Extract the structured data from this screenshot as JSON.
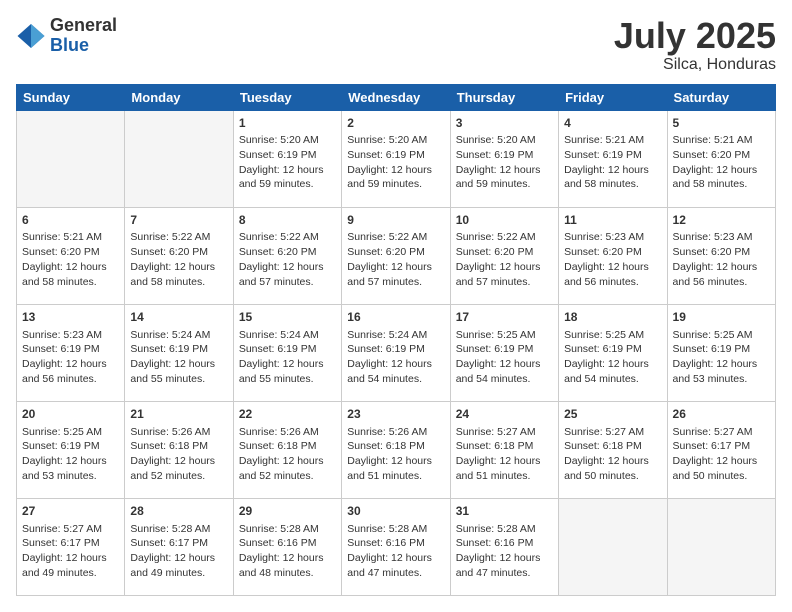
{
  "logo": {
    "general": "General",
    "blue": "Blue"
  },
  "header": {
    "month": "July 2025",
    "location": "Silca, Honduras"
  },
  "weekdays": [
    "Sunday",
    "Monday",
    "Tuesday",
    "Wednesday",
    "Thursday",
    "Friday",
    "Saturday"
  ],
  "weeks": [
    [
      {
        "day": "",
        "empty": true
      },
      {
        "day": "",
        "empty": true
      },
      {
        "day": "1",
        "sunrise": "Sunrise: 5:20 AM",
        "sunset": "Sunset: 6:19 PM",
        "daylight": "Daylight: 12 hours and 59 minutes."
      },
      {
        "day": "2",
        "sunrise": "Sunrise: 5:20 AM",
        "sunset": "Sunset: 6:19 PM",
        "daylight": "Daylight: 12 hours and 59 minutes."
      },
      {
        "day": "3",
        "sunrise": "Sunrise: 5:20 AM",
        "sunset": "Sunset: 6:19 PM",
        "daylight": "Daylight: 12 hours and 59 minutes."
      },
      {
        "day": "4",
        "sunrise": "Sunrise: 5:21 AM",
        "sunset": "Sunset: 6:19 PM",
        "daylight": "Daylight: 12 hours and 58 minutes."
      },
      {
        "day": "5",
        "sunrise": "Sunrise: 5:21 AM",
        "sunset": "Sunset: 6:20 PM",
        "daylight": "Daylight: 12 hours and 58 minutes."
      }
    ],
    [
      {
        "day": "6",
        "sunrise": "Sunrise: 5:21 AM",
        "sunset": "Sunset: 6:20 PM",
        "daylight": "Daylight: 12 hours and 58 minutes."
      },
      {
        "day": "7",
        "sunrise": "Sunrise: 5:22 AM",
        "sunset": "Sunset: 6:20 PM",
        "daylight": "Daylight: 12 hours and 58 minutes."
      },
      {
        "day": "8",
        "sunrise": "Sunrise: 5:22 AM",
        "sunset": "Sunset: 6:20 PM",
        "daylight": "Daylight: 12 hours and 57 minutes."
      },
      {
        "day": "9",
        "sunrise": "Sunrise: 5:22 AM",
        "sunset": "Sunset: 6:20 PM",
        "daylight": "Daylight: 12 hours and 57 minutes."
      },
      {
        "day": "10",
        "sunrise": "Sunrise: 5:22 AM",
        "sunset": "Sunset: 6:20 PM",
        "daylight": "Daylight: 12 hours and 57 minutes."
      },
      {
        "day": "11",
        "sunrise": "Sunrise: 5:23 AM",
        "sunset": "Sunset: 6:20 PM",
        "daylight": "Daylight: 12 hours and 56 minutes."
      },
      {
        "day": "12",
        "sunrise": "Sunrise: 5:23 AM",
        "sunset": "Sunset: 6:20 PM",
        "daylight": "Daylight: 12 hours and 56 minutes."
      }
    ],
    [
      {
        "day": "13",
        "sunrise": "Sunrise: 5:23 AM",
        "sunset": "Sunset: 6:19 PM",
        "daylight": "Daylight: 12 hours and 56 minutes."
      },
      {
        "day": "14",
        "sunrise": "Sunrise: 5:24 AM",
        "sunset": "Sunset: 6:19 PM",
        "daylight": "Daylight: 12 hours and 55 minutes."
      },
      {
        "day": "15",
        "sunrise": "Sunrise: 5:24 AM",
        "sunset": "Sunset: 6:19 PM",
        "daylight": "Daylight: 12 hours and 55 minutes."
      },
      {
        "day": "16",
        "sunrise": "Sunrise: 5:24 AM",
        "sunset": "Sunset: 6:19 PM",
        "daylight": "Daylight: 12 hours and 54 minutes."
      },
      {
        "day": "17",
        "sunrise": "Sunrise: 5:25 AM",
        "sunset": "Sunset: 6:19 PM",
        "daylight": "Daylight: 12 hours and 54 minutes."
      },
      {
        "day": "18",
        "sunrise": "Sunrise: 5:25 AM",
        "sunset": "Sunset: 6:19 PM",
        "daylight": "Daylight: 12 hours and 54 minutes."
      },
      {
        "day": "19",
        "sunrise": "Sunrise: 5:25 AM",
        "sunset": "Sunset: 6:19 PM",
        "daylight": "Daylight: 12 hours and 53 minutes."
      }
    ],
    [
      {
        "day": "20",
        "sunrise": "Sunrise: 5:25 AM",
        "sunset": "Sunset: 6:19 PM",
        "daylight": "Daylight: 12 hours and 53 minutes."
      },
      {
        "day": "21",
        "sunrise": "Sunrise: 5:26 AM",
        "sunset": "Sunset: 6:18 PM",
        "daylight": "Daylight: 12 hours and 52 minutes."
      },
      {
        "day": "22",
        "sunrise": "Sunrise: 5:26 AM",
        "sunset": "Sunset: 6:18 PM",
        "daylight": "Daylight: 12 hours and 52 minutes."
      },
      {
        "day": "23",
        "sunrise": "Sunrise: 5:26 AM",
        "sunset": "Sunset: 6:18 PM",
        "daylight": "Daylight: 12 hours and 51 minutes."
      },
      {
        "day": "24",
        "sunrise": "Sunrise: 5:27 AM",
        "sunset": "Sunset: 6:18 PM",
        "daylight": "Daylight: 12 hours and 51 minutes."
      },
      {
        "day": "25",
        "sunrise": "Sunrise: 5:27 AM",
        "sunset": "Sunset: 6:18 PM",
        "daylight": "Daylight: 12 hours and 50 minutes."
      },
      {
        "day": "26",
        "sunrise": "Sunrise: 5:27 AM",
        "sunset": "Sunset: 6:17 PM",
        "daylight": "Daylight: 12 hours and 50 minutes."
      }
    ],
    [
      {
        "day": "27",
        "sunrise": "Sunrise: 5:27 AM",
        "sunset": "Sunset: 6:17 PM",
        "daylight": "Daylight: 12 hours and 49 minutes."
      },
      {
        "day": "28",
        "sunrise": "Sunrise: 5:28 AM",
        "sunset": "Sunset: 6:17 PM",
        "daylight": "Daylight: 12 hours and 49 minutes."
      },
      {
        "day": "29",
        "sunrise": "Sunrise: 5:28 AM",
        "sunset": "Sunset: 6:16 PM",
        "daylight": "Daylight: 12 hours and 48 minutes."
      },
      {
        "day": "30",
        "sunrise": "Sunrise: 5:28 AM",
        "sunset": "Sunset: 6:16 PM",
        "daylight": "Daylight: 12 hours and 47 minutes."
      },
      {
        "day": "31",
        "sunrise": "Sunrise: 5:28 AM",
        "sunset": "Sunset: 6:16 PM",
        "daylight": "Daylight: 12 hours and 47 minutes."
      },
      {
        "day": "",
        "empty": true
      },
      {
        "day": "",
        "empty": true
      }
    ]
  ]
}
